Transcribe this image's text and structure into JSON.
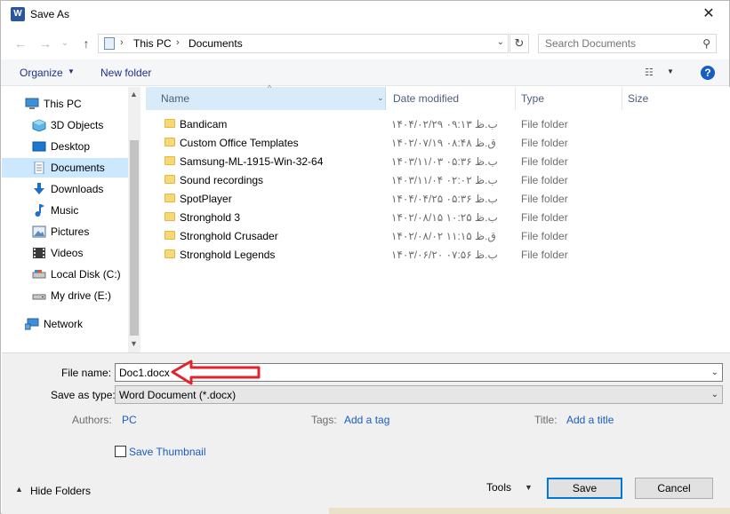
{
  "window": {
    "title": "Save As",
    "app_icon_letter": "W",
    "close_glyph": "✕"
  },
  "address": {
    "back_glyph": "←",
    "forward_glyph": "→",
    "dropdown_glyph": "⌄",
    "up_glyph": "↑",
    "path": [
      "This PC",
      "Documents"
    ],
    "separator": "›",
    "refresh_glyph": "↻",
    "search_placeholder": "Search Documents",
    "search_glyph": "⚲"
  },
  "toolbar": {
    "organize_label": "Organize",
    "organize_arrow": "▼",
    "new_folder_label": "New folder",
    "view_glyph": "☷",
    "view_arrow": "▼",
    "help_glyph": "?"
  },
  "nav": {
    "scroll_up": "▲",
    "scroll_down": "▼",
    "items": [
      {
        "label": "This PC",
        "icon": "computer-icon",
        "selected": false
      },
      {
        "label": "3D Objects",
        "icon": "cube-icon",
        "selected": false
      },
      {
        "label": "Desktop",
        "icon": "desktop-icon",
        "selected": false
      },
      {
        "label": "Documents",
        "icon": "documents-icon",
        "selected": true
      },
      {
        "label": "Downloads",
        "icon": "download-icon",
        "selected": false
      },
      {
        "label": "Music",
        "icon": "music-icon",
        "selected": false
      },
      {
        "label": "Pictures",
        "icon": "pictures-icon",
        "selected": false
      },
      {
        "label": "Videos",
        "icon": "videos-icon",
        "selected": false
      },
      {
        "label": "Local Disk (C:)",
        "icon": "local-disk-icon",
        "selected": false
      },
      {
        "label": "My drive (E:)",
        "icon": "drive-icon",
        "selected": false
      },
      {
        "label": "Network",
        "icon": "network-icon",
        "selected": false
      }
    ]
  },
  "columns": {
    "name": "Name",
    "date": "Date modified",
    "type": "Type",
    "size": "Size",
    "sort_glyph": "^",
    "name_chevron": "⌄"
  },
  "files": [
    {
      "name": "Bandicam",
      "date": "۱۴۰۴/۰۲/۲۹ ب.ظ ۰۹:۱۳",
      "type": "File folder"
    },
    {
      "name": "Custom Office Templates",
      "date": "۱۴۰۲/۰۷/۱۹ ق.ظ ۰۸:۴۸",
      "type": "File folder"
    },
    {
      "name": "Samsung-ML-1915-Win-32-64",
      "date": "۱۴۰۳/۱۱/۰۳ ب.ظ ۰۵:۳۶",
      "type": "File folder"
    },
    {
      "name": "Sound recordings",
      "date": "۱۴۰۳/۱۱/۰۴ ب.ظ ۰۲:۰۲",
      "type": "File folder"
    },
    {
      "name": "SpotPlayer",
      "date": "۱۴۰۴/۰۴/۲۵ ب.ظ ۰۵:۳۶",
      "type": "File folder"
    },
    {
      "name": "Stronghold 3",
      "date": "۱۴۰۲/۰۸/۱۵ ب.ظ ۱۰:۲۵",
      "type": "File folder"
    },
    {
      "name": "Stronghold Crusader",
      "date": "۱۴۰۲/۰۸/۰۲ ق.ظ ۱۱:۱۵",
      "type": "File folder"
    },
    {
      "name": "Stronghold Legends",
      "date": "۱۴۰۳/۰۶/۲۰ ب.ظ ۰۷:۵۶",
      "type": "File folder"
    }
  ],
  "form": {
    "filename_label": "File name:",
    "filename_value": "Doc1.docx",
    "savetype_label": "Save as type:",
    "savetype_value": "Word Document (*.docx)",
    "dropdown_caret": "⌄",
    "authors_label": "Authors:",
    "authors_value": "PC",
    "tags_label": "Tags:",
    "tags_value": "Add a tag",
    "title_label": "Title:",
    "title_value": "Add a title",
    "thumbnail_label": "Save Thumbnail"
  },
  "footer": {
    "hide_folders_arrow": "▲",
    "hide_folders_label": "Hide Folders",
    "tools_label": "Tools",
    "tools_arrow": "▼",
    "save_label": "Save",
    "cancel_label": "Cancel"
  },
  "colors": {
    "selected_bg": "#cce8ff",
    "link": "#1a5cc5",
    "annotation_arrow": "#e0242b"
  }
}
